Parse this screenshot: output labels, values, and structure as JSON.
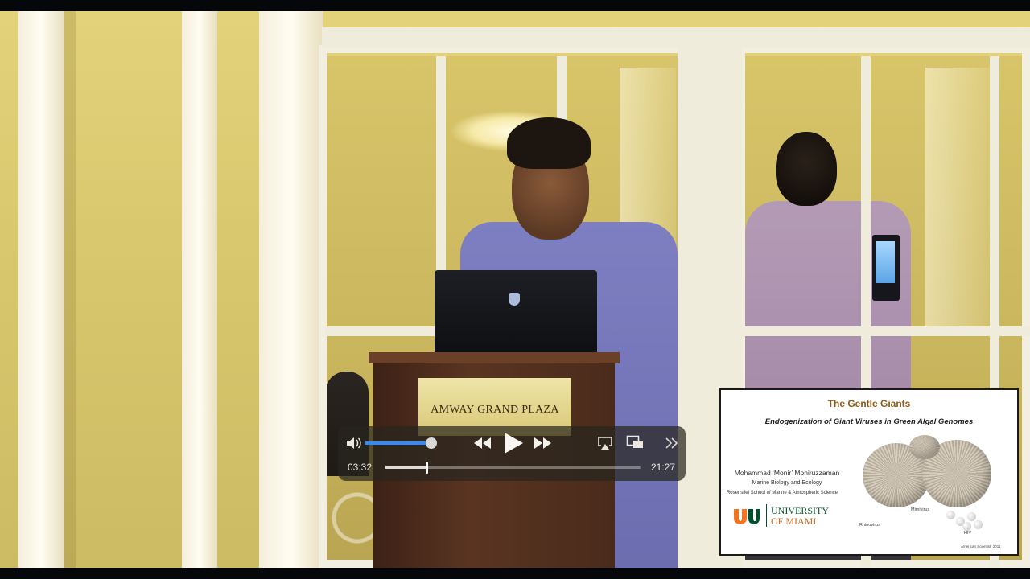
{
  "podium": {
    "plaque": "AMWAY GRAND PLAZA"
  },
  "player": {
    "current_time": "03:32",
    "duration": "21:27",
    "progress": 0.165,
    "volume": 0.96,
    "icons": {
      "volume": "speaker-icon",
      "rewind": "rewind-icon",
      "play": "play-icon",
      "forward": "fast-forward-icon",
      "airplay": "airplay-icon",
      "pip": "picture-in-picture-icon",
      "more": "chevron-double-right-icon"
    },
    "accent_color": "#2f8bff"
  },
  "slide": {
    "title": "The Gentle Giants",
    "subtitle": "Endogenization of Giant Viruses in Green Algal Genomes",
    "author": "Mohammad ‘Monir’ Moniruzzaman",
    "department": "Marine Biology and Ecology",
    "school": "Rosenstiel School of Marine & Atmospheric Science",
    "university_line1": "UNIVERSITY",
    "university_line2": "OF MIAMI",
    "image_labels": {
      "left": "Rhinovirus",
      "middle": "Mimivirus",
      "right": "HIV"
    },
    "credit": "American Scientist, 2011",
    "title_color": "#8a5a1a"
  }
}
